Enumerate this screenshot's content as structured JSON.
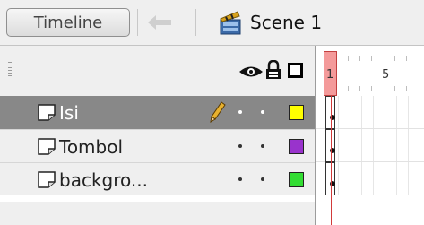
{
  "toolbar": {
    "timeline_button": "Timeline",
    "back_icon": "back-arrow-icon",
    "scene_icon": "clapperboard-icon",
    "scene_label": "Scene 1"
  },
  "header": {
    "eye_icon": "eye-icon",
    "lock_icon": "lock-icon",
    "outline_icon": "outline-square-icon"
  },
  "frame_numbers": [
    "1",
    "5"
  ],
  "layers": [
    {
      "name": "Isi",
      "selected": true,
      "outline_color": "#ffff00",
      "pencil_icon": "pencil-icon"
    },
    {
      "name": "Tombol",
      "selected": false,
      "outline_color": "#9933cc"
    },
    {
      "name": "backgro...",
      "selected": false,
      "outline_color": "#33dd33"
    }
  ],
  "colors": {
    "playhead": "#f49a9a",
    "selected_layer": "#888888"
  }
}
